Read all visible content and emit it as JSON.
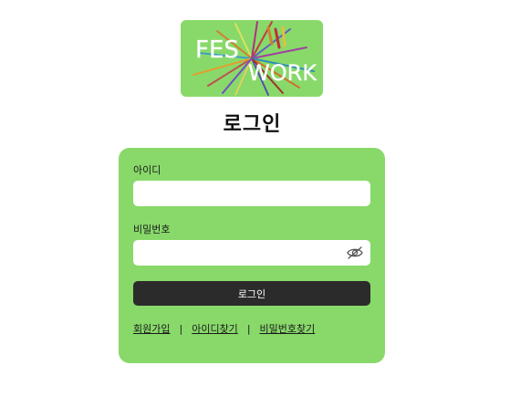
{
  "logo": {
    "line1": "FES",
    "line2": "WORK",
    "background_color": "#88d96a"
  },
  "page_title": "로그인",
  "form": {
    "id_label": "아이디",
    "id_value": "",
    "password_label": "비밀번호",
    "password_value": "",
    "password_toggle_icon": "eye-slash-icon",
    "submit_label": "로그인"
  },
  "links": {
    "signup": "회원가입",
    "find_id": "아이디찾기",
    "find_password": "비밀번호찾기",
    "separator": "|"
  },
  "colors": {
    "card_background": "#88d96a",
    "button_background": "#2b2b2b",
    "button_text": "#ffffff"
  }
}
